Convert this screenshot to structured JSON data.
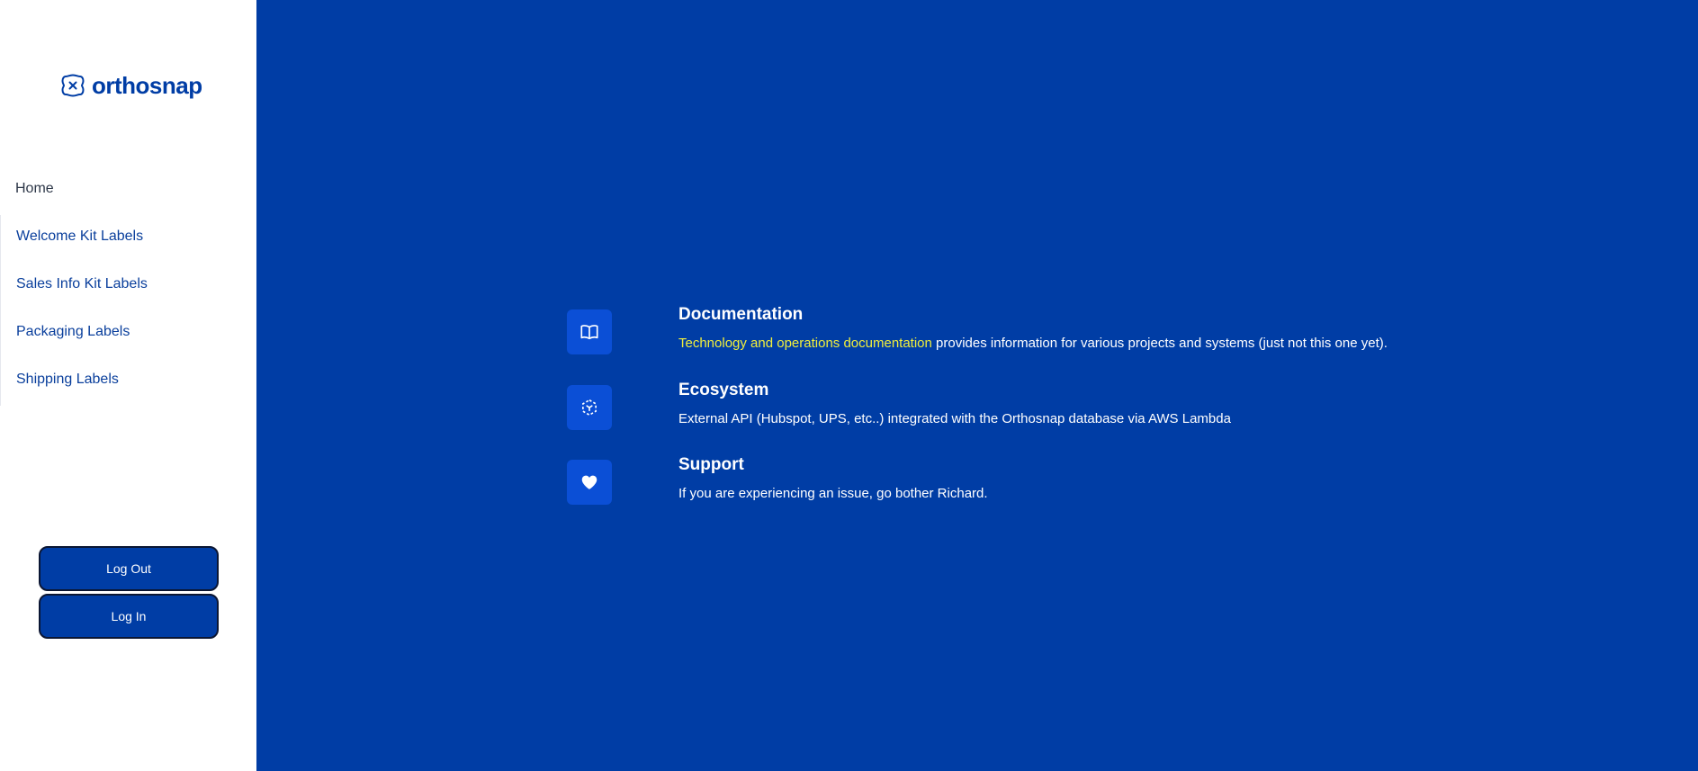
{
  "brand": {
    "name": "orthosnap",
    "logo_icon": "close-x-badge-icon"
  },
  "nav": {
    "items": [
      {
        "label": "Home"
      },
      {
        "label": "Welcome Kit Labels"
      },
      {
        "label": "Sales Info Kit Labels"
      },
      {
        "label": "Packaging Labels"
      },
      {
        "label": "Shipping Labels"
      }
    ]
  },
  "auth": {
    "logout_label": "Log Out",
    "login_label": "Log In"
  },
  "features": [
    {
      "icon": "book-icon",
      "title": "Documentation",
      "link_text": "Technology and operations documentation",
      "desc": " provides information for various projects and systems (just not this one yet)."
    },
    {
      "icon": "ecosystem-icon",
      "title": "Ecosystem",
      "desc": "External API (Hubspot, UPS, etc..) integrated with the Orthosnap database via AWS Lambda"
    },
    {
      "icon": "heart-icon",
      "title": "Support",
      "desc": "If you are experiencing an issue, go bother Richard."
    }
  ],
  "colors": {
    "primary": "#003da5",
    "icon_bg": "#0b4fd6",
    "link_highlight": "#f0ee3c",
    "sidebar_bg": "#ffffff"
  }
}
